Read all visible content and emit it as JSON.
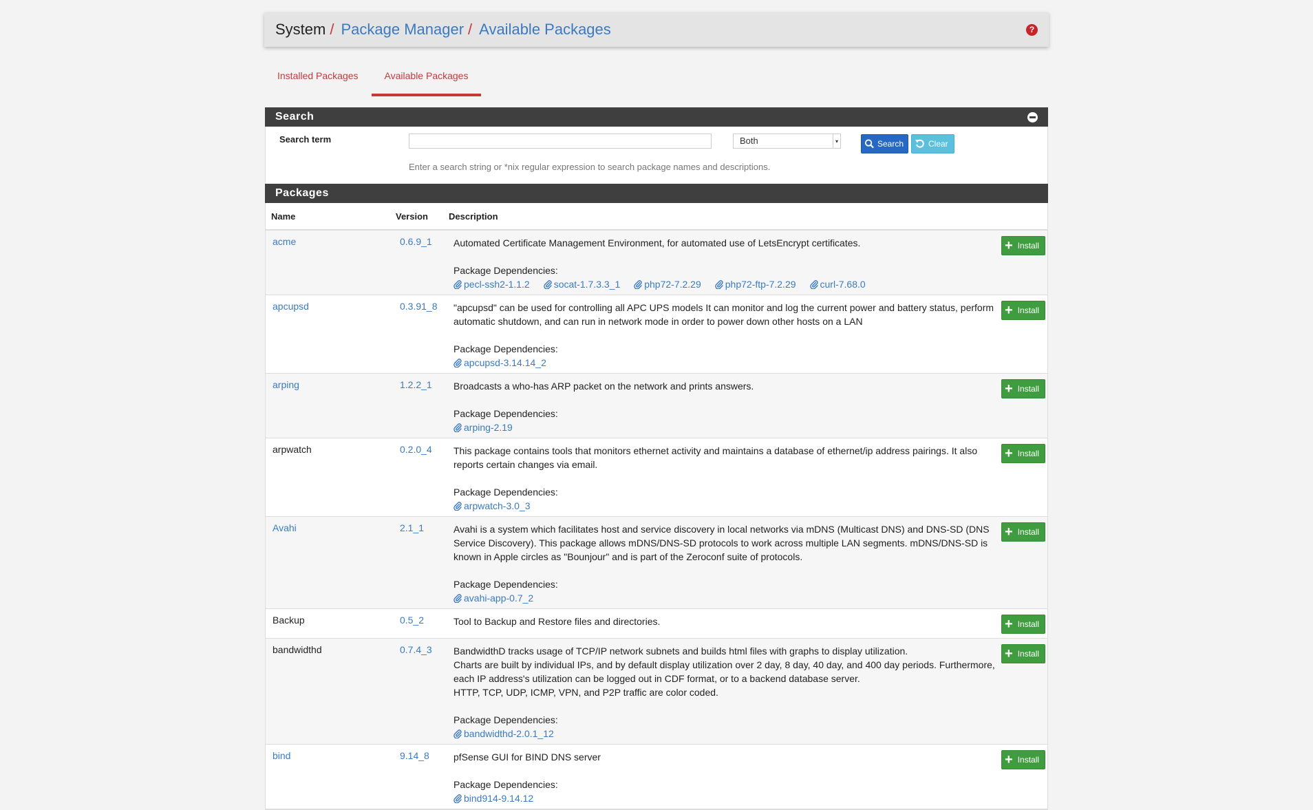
{
  "breadcrumb": {
    "root": "System",
    "sep": "/",
    "level1": "Package Manager",
    "level2": "Available Packages",
    "help_glyph": "?"
  },
  "tabs": [
    {
      "label": "Installed Packages",
      "active": false
    },
    {
      "label": "Available Packages",
      "active": true
    }
  ],
  "search": {
    "panel_title": "Search",
    "term_label": "Search term",
    "input_value": "",
    "scope_selected": "Both",
    "search_button": "Search",
    "clear_button": "Clear",
    "help_text": "Enter a search string or *nix regular expression to search package names and descriptions."
  },
  "packages": {
    "panel_title": "Packages",
    "columns": {
      "name": "Name",
      "version": "Version",
      "description": "Description"
    },
    "deps_label": "Package Dependencies:",
    "install_label": "Install",
    "rows": [
      {
        "name": "acme",
        "name_is_link": true,
        "version": "0.6.9_1",
        "description": [
          "Automated Certificate Management Environment, for automated use of LetsEncrypt certificates."
        ],
        "deps": [
          "pecl-ssh2-1.1.2",
          "socat-1.7.3.3_1",
          "php72-7.2.29",
          "php72-ftp-7.2.29",
          "curl-7.68.0"
        ]
      },
      {
        "name": "apcupsd",
        "name_is_link": true,
        "version": "0.3.91_8",
        "description": [
          "\"apcupsd\" can be used for controlling all APC UPS models It can monitor and log the current power and battery status, perform automatic shutdown, and can run in network mode in order to power down other hosts on a LAN"
        ],
        "deps": [
          "apcupsd-3.14.14_2"
        ]
      },
      {
        "name": "arping",
        "name_is_link": true,
        "version": "1.2.2_1",
        "description": [
          "Broadcasts a who-has ARP packet on the network and prints answers."
        ],
        "deps": [
          "arping-2.19"
        ]
      },
      {
        "name": "arpwatch",
        "name_is_link": false,
        "version": "0.2.0_4",
        "description": [
          "This package contains tools that monitors ethernet activity and maintains a database of ethernet/ip address pairings. It also reports certain changes via email."
        ],
        "deps": [
          "arpwatch-3.0_3"
        ]
      },
      {
        "name": "Avahi",
        "name_is_link": true,
        "version": "2.1_1",
        "description": [
          "Avahi is a system which facilitates host and service discovery in local networks via mDNS (Multicast DNS) and DNS-SD (DNS Service Discovery). This package allows mDNS/DNS-SD protocols to work across multiple LAN segments. mDNS/DNS-SD is known in Apple circles as \"Bounjour\" and is part of the Zeroconf suite of protocols."
        ],
        "deps": [
          "avahi-app-0.7_2"
        ]
      },
      {
        "name": "Backup",
        "name_is_link": false,
        "version": "0.5_2",
        "description": [
          "Tool to Backup and Restore files and directories."
        ],
        "deps": []
      },
      {
        "name": "bandwidthd",
        "name_is_link": false,
        "version": "0.7.4_3",
        "description": [
          "BandwidthD tracks usage of TCP/IP network subnets and builds html files with graphs to display utilization.",
          "Charts are built by individual IPs, and by default display utilization over 2 day, 8 day, 40 day, and 400 day periods. Furthermore, each IP address's utilization can be logged out in CDF format, or to a backend database server.",
          "HTTP, TCP, UDP, ICMP, VPN, and P2P traffic are color coded."
        ],
        "deps": [
          "bandwidthd-2.0.1_12"
        ]
      },
      {
        "name": "bind",
        "name_is_link": true,
        "version": "9.14_8",
        "description": [
          "pfSense GUI for BIND DNS server"
        ],
        "deps": [
          "bind914-9.14.12"
        ]
      }
    ]
  }
}
